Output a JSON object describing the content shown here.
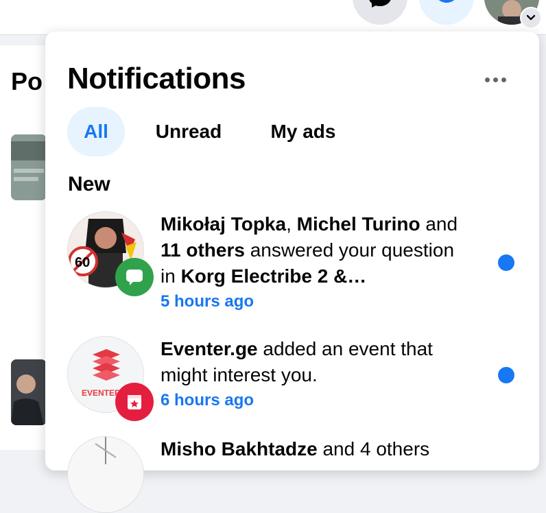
{
  "colors": {
    "accent": "#1877f2",
    "tab_active_bg": "#e7f3ff",
    "badge_message": "#31a24c",
    "badge_event": "#e41e3f"
  },
  "background": {
    "page_title": "Po"
  },
  "topbar": {
    "messenger_icon": "messenger-icon",
    "notifications_icon": "bell-icon",
    "account_icon": "account-avatar"
  },
  "notifications": {
    "title": "Notifications",
    "more_icon": "more-horizontal-icon",
    "tabs": [
      {
        "label": "All",
        "active": true
      },
      {
        "label": "Unread",
        "active": false
      },
      {
        "label": "My ads",
        "active": false
      }
    ],
    "section_label": "New",
    "items": [
      {
        "name_1": "Mikołaj Topka",
        "sep_1": ", ",
        "name_2": "Michel Turino",
        "text_1": " and ",
        "count": "11 others",
        "text_2": " answered your question in ",
        "group": "Korg Electribe 2 &…",
        "time": "5 hours ago",
        "badge_icon": "message-bubble-icon",
        "unread": true
      },
      {
        "name_1": "Eventer.ge",
        "text_1": " added an event that might interest you.",
        "avatar_label": "EVENTER",
        "time": "6 hours ago",
        "badge_icon": "event-star-icon",
        "unread": true
      },
      {
        "name_1": "Misho Bakhtadze",
        "text_1": " and 4 others"
      }
    ]
  }
}
